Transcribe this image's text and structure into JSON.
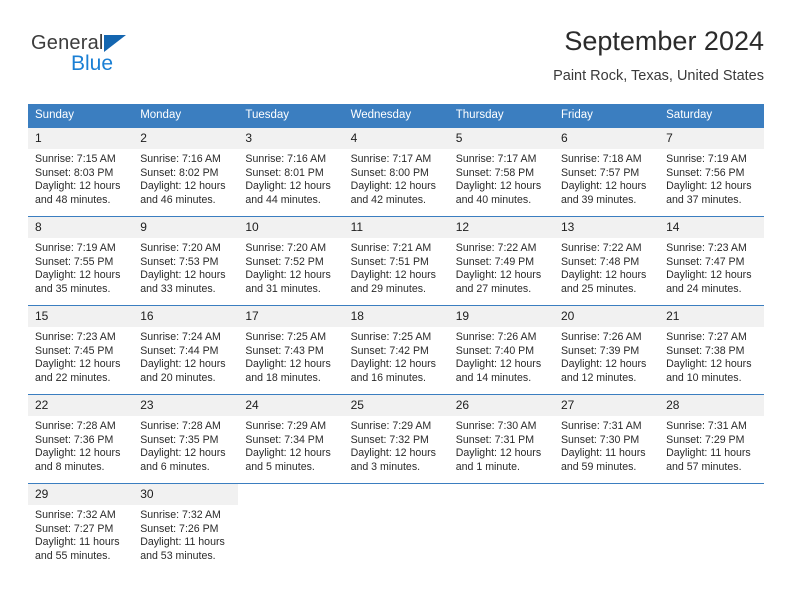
{
  "logo": {
    "line1": "General",
    "line2": "Blue",
    "triangle_icon": "blue-triangle-icon",
    "line1_color": "#3c3c3c",
    "line2_color": "#1a7fd4",
    "triangle_color": "#1466b0"
  },
  "header": {
    "title": "September 2024",
    "subtitle": "Paint Rock, Texas, United States"
  },
  "theme": {
    "header_blue": "#3b7ec0",
    "daynum_gray": "#f1f1f1",
    "text": "#2a2a2a"
  },
  "calendar": {
    "weekday_headers": [
      "Sunday",
      "Monday",
      "Tuesday",
      "Wednesday",
      "Thursday",
      "Friday",
      "Saturday"
    ],
    "weeks": [
      [
        {
          "day": "1",
          "sunrise": "Sunrise: 7:15 AM",
          "sunset": "Sunset: 8:03 PM",
          "daylight": "Daylight: 12 hours and 48 minutes."
        },
        {
          "day": "2",
          "sunrise": "Sunrise: 7:16 AM",
          "sunset": "Sunset: 8:02 PM",
          "daylight": "Daylight: 12 hours and 46 minutes."
        },
        {
          "day": "3",
          "sunrise": "Sunrise: 7:16 AM",
          "sunset": "Sunset: 8:01 PM",
          "daylight": "Daylight: 12 hours and 44 minutes."
        },
        {
          "day": "4",
          "sunrise": "Sunrise: 7:17 AM",
          "sunset": "Sunset: 8:00 PM",
          "daylight": "Daylight: 12 hours and 42 minutes."
        },
        {
          "day": "5",
          "sunrise": "Sunrise: 7:17 AM",
          "sunset": "Sunset: 7:58 PM",
          "daylight": "Daylight: 12 hours and 40 minutes."
        },
        {
          "day": "6",
          "sunrise": "Sunrise: 7:18 AM",
          "sunset": "Sunset: 7:57 PM",
          "daylight": "Daylight: 12 hours and 39 minutes."
        },
        {
          "day": "7",
          "sunrise": "Sunrise: 7:19 AM",
          "sunset": "Sunset: 7:56 PM",
          "daylight": "Daylight: 12 hours and 37 minutes."
        }
      ],
      [
        {
          "day": "8",
          "sunrise": "Sunrise: 7:19 AM",
          "sunset": "Sunset: 7:55 PM",
          "daylight": "Daylight: 12 hours and 35 minutes."
        },
        {
          "day": "9",
          "sunrise": "Sunrise: 7:20 AM",
          "sunset": "Sunset: 7:53 PM",
          "daylight": "Daylight: 12 hours and 33 minutes."
        },
        {
          "day": "10",
          "sunrise": "Sunrise: 7:20 AM",
          "sunset": "Sunset: 7:52 PM",
          "daylight": "Daylight: 12 hours and 31 minutes."
        },
        {
          "day": "11",
          "sunrise": "Sunrise: 7:21 AM",
          "sunset": "Sunset: 7:51 PM",
          "daylight": "Daylight: 12 hours and 29 minutes."
        },
        {
          "day": "12",
          "sunrise": "Sunrise: 7:22 AM",
          "sunset": "Sunset: 7:49 PM",
          "daylight": "Daylight: 12 hours and 27 minutes."
        },
        {
          "day": "13",
          "sunrise": "Sunrise: 7:22 AM",
          "sunset": "Sunset: 7:48 PM",
          "daylight": "Daylight: 12 hours and 25 minutes."
        },
        {
          "day": "14",
          "sunrise": "Sunrise: 7:23 AM",
          "sunset": "Sunset: 7:47 PM",
          "daylight": "Daylight: 12 hours and 24 minutes."
        }
      ],
      [
        {
          "day": "15",
          "sunrise": "Sunrise: 7:23 AM",
          "sunset": "Sunset: 7:45 PM",
          "daylight": "Daylight: 12 hours and 22 minutes."
        },
        {
          "day": "16",
          "sunrise": "Sunrise: 7:24 AM",
          "sunset": "Sunset: 7:44 PM",
          "daylight": "Daylight: 12 hours and 20 minutes."
        },
        {
          "day": "17",
          "sunrise": "Sunrise: 7:25 AM",
          "sunset": "Sunset: 7:43 PM",
          "daylight": "Daylight: 12 hours and 18 minutes."
        },
        {
          "day": "18",
          "sunrise": "Sunrise: 7:25 AM",
          "sunset": "Sunset: 7:42 PM",
          "daylight": "Daylight: 12 hours and 16 minutes."
        },
        {
          "day": "19",
          "sunrise": "Sunrise: 7:26 AM",
          "sunset": "Sunset: 7:40 PM",
          "daylight": "Daylight: 12 hours and 14 minutes."
        },
        {
          "day": "20",
          "sunrise": "Sunrise: 7:26 AM",
          "sunset": "Sunset: 7:39 PM",
          "daylight": "Daylight: 12 hours and 12 minutes."
        },
        {
          "day": "21",
          "sunrise": "Sunrise: 7:27 AM",
          "sunset": "Sunset: 7:38 PM",
          "daylight": "Daylight: 12 hours and 10 minutes."
        }
      ],
      [
        {
          "day": "22",
          "sunrise": "Sunrise: 7:28 AM",
          "sunset": "Sunset: 7:36 PM",
          "daylight": "Daylight: 12 hours and 8 minutes."
        },
        {
          "day": "23",
          "sunrise": "Sunrise: 7:28 AM",
          "sunset": "Sunset: 7:35 PM",
          "daylight": "Daylight: 12 hours and 6 minutes."
        },
        {
          "day": "24",
          "sunrise": "Sunrise: 7:29 AM",
          "sunset": "Sunset: 7:34 PM",
          "daylight": "Daylight: 12 hours and 5 minutes."
        },
        {
          "day": "25",
          "sunrise": "Sunrise: 7:29 AM",
          "sunset": "Sunset: 7:32 PM",
          "daylight": "Daylight: 12 hours and 3 minutes."
        },
        {
          "day": "26",
          "sunrise": "Sunrise: 7:30 AM",
          "sunset": "Sunset: 7:31 PM",
          "daylight": "Daylight: 12 hours and 1 minute."
        },
        {
          "day": "27",
          "sunrise": "Sunrise: 7:31 AM",
          "sunset": "Sunset: 7:30 PM",
          "daylight": "Daylight: 11 hours and 59 minutes."
        },
        {
          "day": "28",
          "sunrise": "Sunrise: 7:31 AM",
          "sunset": "Sunset: 7:29 PM",
          "daylight": "Daylight: 11 hours and 57 minutes."
        }
      ],
      [
        {
          "day": "29",
          "sunrise": "Sunrise: 7:32 AM",
          "sunset": "Sunset: 7:27 PM",
          "daylight": "Daylight: 11 hours and 55 minutes."
        },
        {
          "day": "30",
          "sunrise": "Sunrise: 7:32 AM",
          "sunset": "Sunset: 7:26 PM",
          "daylight": "Daylight: 11 hours and 53 minutes."
        },
        {
          "day": "",
          "sunrise": "",
          "sunset": "",
          "daylight": ""
        },
        {
          "day": "",
          "sunrise": "",
          "sunset": "",
          "daylight": ""
        },
        {
          "day": "",
          "sunrise": "",
          "sunset": "",
          "daylight": ""
        },
        {
          "day": "",
          "sunrise": "",
          "sunset": "",
          "daylight": ""
        },
        {
          "day": "",
          "sunrise": "",
          "sunset": "",
          "daylight": ""
        }
      ]
    ]
  }
}
